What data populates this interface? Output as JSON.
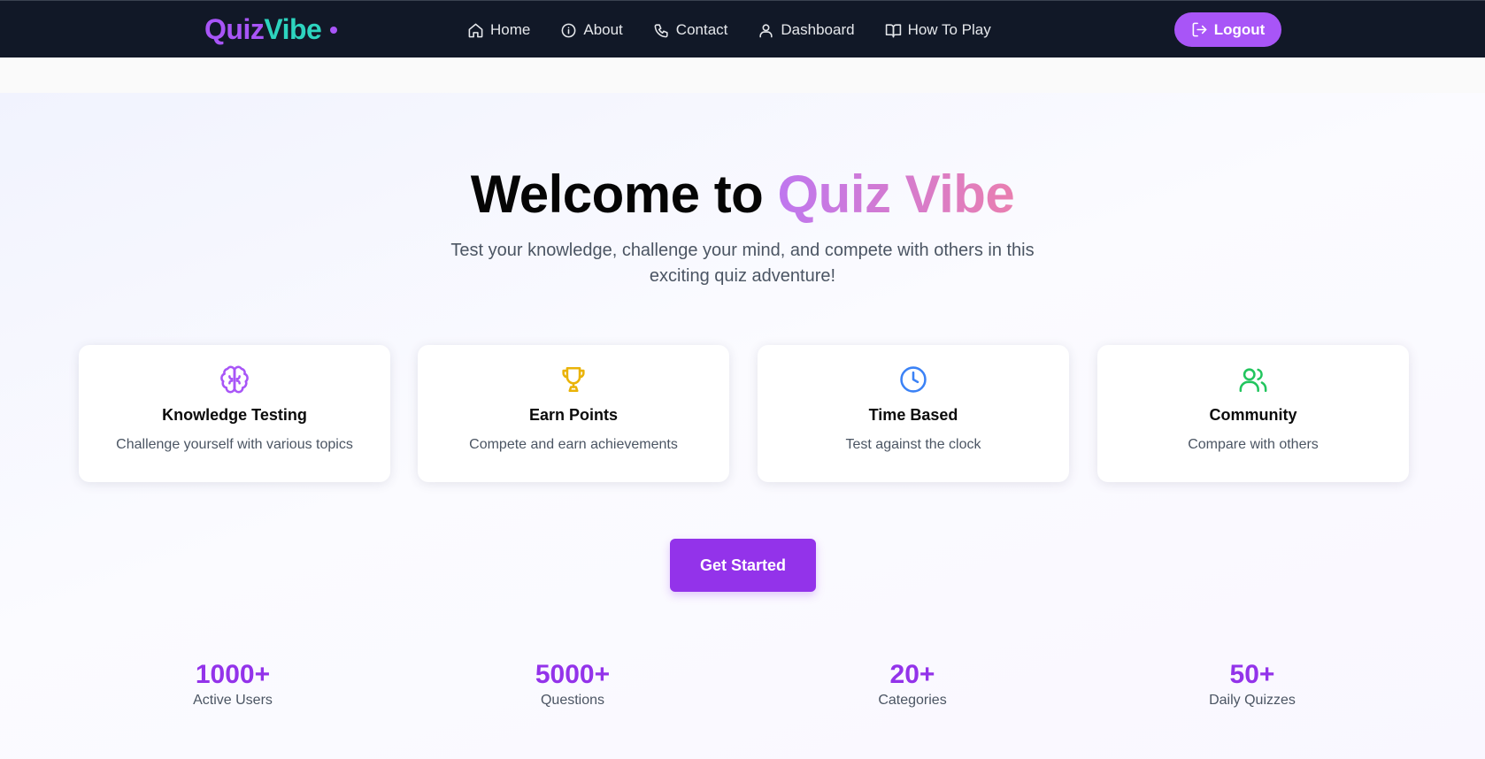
{
  "brand": {
    "part1": "Quiz",
    "part2": "Vibe"
  },
  "nav": {
    "items": [
      {
        "label": "Home",
        "icon": "home-icon"
      },
      {
        "label": "About",
        "icon": "info-icon"
      },
      {
        "label": "Contact",
        "icon": "phone-icon"
      },
      {
        "label": "Dashboard",
        "icon": "user-icon"
      },
      {
        "label": "How To Play",
        "icon": "book-icon"
      }
    ],
    "logout_label": "Logout"
  },
  "hero": {
    "title_prefix": "Welcome to ",
    "title_accent": "Quiz Vibe",
    "subtitle": "Test your knowledge, challenge your mind, and compete with others in this exciting quiz adventure!"
  },
  "features": [
    {
      "title": "Knowledge Testing",
      "desc": "Challenge yourself with various topics",
      "icon": "brain-icon",
      "color": "#a855f7"
    },
    {
      "title": "Earn Points",
      "desc": "Compete and earn achievements",
      "icon": "trophy-icon",
      "color": "#eab308"
    },
    {
      "title": "Time Based",
      "desc": "Test against the clock",
      "icon": "clock-icon",
      "color": "#3b82f6"
    },
    {
      "title": "Community",
      "desc": "Compare with others",
      "icon": "users-icon",
      "color": "#22c55e"
    }
  ],
  "cta": {
    "label": "Get Started"
  },
  "stats": [
    {
      "value": "1000+",
      "label": "Active Users"
    },
    {
      "value": "5000+",
      "label": "Questions"
    },
    {
      "value": "20+",
      "label": "Categories"
    },
    {
      "value": "50+",
      "label": "Daily Quizzes"
    }
  ],
  "colors": {
    "nav_bg": "#111827",
    "brand_purple": "#a855f7",
    "brand_teal": "#2dd4bf",
    "cta_purple": "#9333ea"
  }
}
